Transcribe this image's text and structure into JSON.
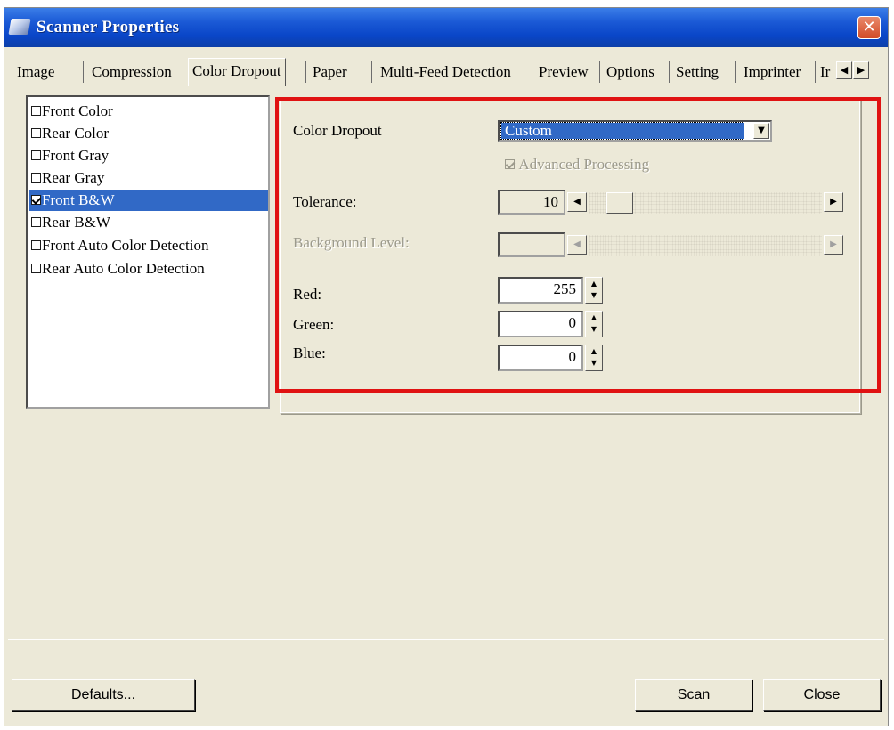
{
  "window": {
    "title": "Scanner Properties",
    "close_glyph": "✕"
  },
  "tabs": [
    {
      "label": "Image"
    },
    {
      "label": "Compression"
    },
    {
      "label": "Color Dropout"
    },
    {
      "label": "Paper"
    },
    {
      "label": "Multi-Feed Detection"
    },
    {
      "label": "Preview"
    },
    {
      "label": "Options"
    },
    {
      "label": "Setting"
    },
    {
      "label": "Imprinter"
    },
    {
      "label": "Ir"
    }
  ],
  "active_tab": "Color Dropout",
  "image_list": [
    {
      "label": "Front Color",
      "checked": false
    },
    {
      "label": "Rear Color",
      "checked": false
    },
    {
      "label": "Front Gray",
      "checked": false
    },
    {
      "label": "Rear Gray",
      "checked": false
    },
    {
      "label": "Front B&W",
      "checked": true,
      "selected": true
    },
    {
      "label": "Rear B&W",
      "checked": false
    },
    {
      "label": "Front Auto Color Detection",
      "checked": false
    },
    {
      "label": "Rear Auto Color Detection",
      "checked": false
    }
  ],
  "color_dropout": {
    "label": "Color Dropout",
    "value": "Custom",
    "advanced_processing": {
      "label": "Advanced Processing",
      "checked": true,
      "enabled": false
    },
    "tolerance": {
      "label": "Tolerance:",
      "value": "10"
    },
    "background_level": {
      "label": "Background Level:",
      "value": "",
      "enabled": false
    },
    "red": {
      "label": "Red:",
      "value": "255"
    },
    "green": {
      "label": "Green:",
      "value": "0"
    },
    "blue": {
      "label": "Blue:",
      "value": "0"
    }
  },
  "buttons": {
    "defaults": "Defaults...",
    "scan": "Scan",
    "close": "Close"
  },
  "colors": {
    "titlebar": "#0a46c8",
    "selection": "#3169c6",
    "highlight_frame": "#e01212",
    "dialog_face": "#ece9d8"
  }
}
